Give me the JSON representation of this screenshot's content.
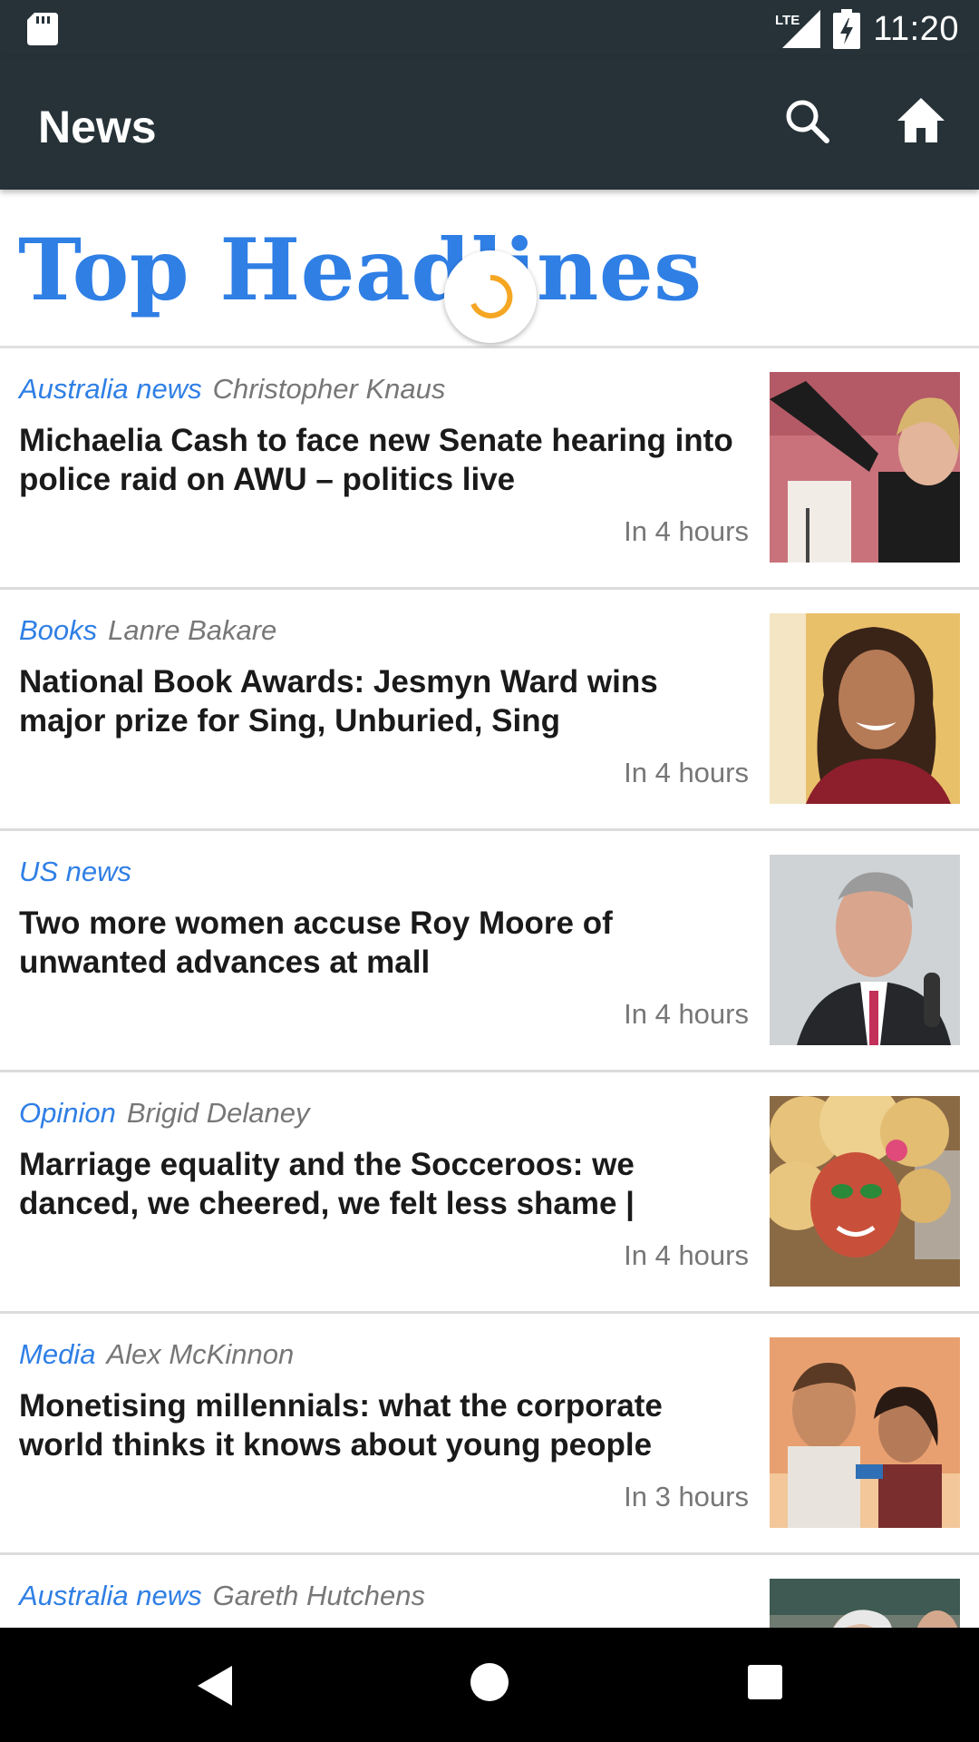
{
  "status_bar": {
    "time": "11:20",
    "network": "LTE",
    "icons": [
      "sd-card-icon",
      "lte-signal-icon",
      "battery-charging-icon"
    ]
  },
  "app_bar": {
    "title": "News",
    "actions": [
      "search-icon",
      "home-icon"
    ]
  },
  "page": {
    "heading": "Top Headlines",
    "loading": true,
    "colors": {
      "accent": "#2f7fe5",
      "toolbar": "#263238",
      "spinner": "#f5a623"
    }
  },
  "articles": [
    {
      "section": "Australia news",
      "author": "Christopher Knaus",
      "title": "Michaelia Cash to face new Senate hearing into police raid on AWU – politics live",
      "time": "In 4 hours"
    },
    {
      "section": "Books",
      "author": "Lanre Bakare",
      "title": "National Book Awards: Jesmyn Ward wins major prize for Sing, Unburied, Sing",
      "time": "In 4 hours"
    },
    {
      "section": "US news",
      "author": "",
      "title": "Two more women accuse Roy Moore of unwanted advances at mall",
      "time": "In 4 hours"
    },
    {
      "section": "Opinion",
      "author": "Brigid Delaney",
      "title": "Marriage equality and the Socceroos: we danced, we cheered, we felt less shame | Brigid…",
      "time": "In 4 hours"
    },
    {
      "section": "Media",
      "author": "Alex McKinnon",
      "title": "Monetising millennials: what the corporate world thinks it knows about young people",
      "time": "In 3 hours"
    },
    {
      "section": "Australia news",
      "author": "Gareth Hutchens",
      "title": "",
      "time": ""
    }
  ],
  "nav_bar": {
    "buttons": [
      "back-icon",
      "home-circle-icon",
      "recents-icon"
    ]
  }
}
